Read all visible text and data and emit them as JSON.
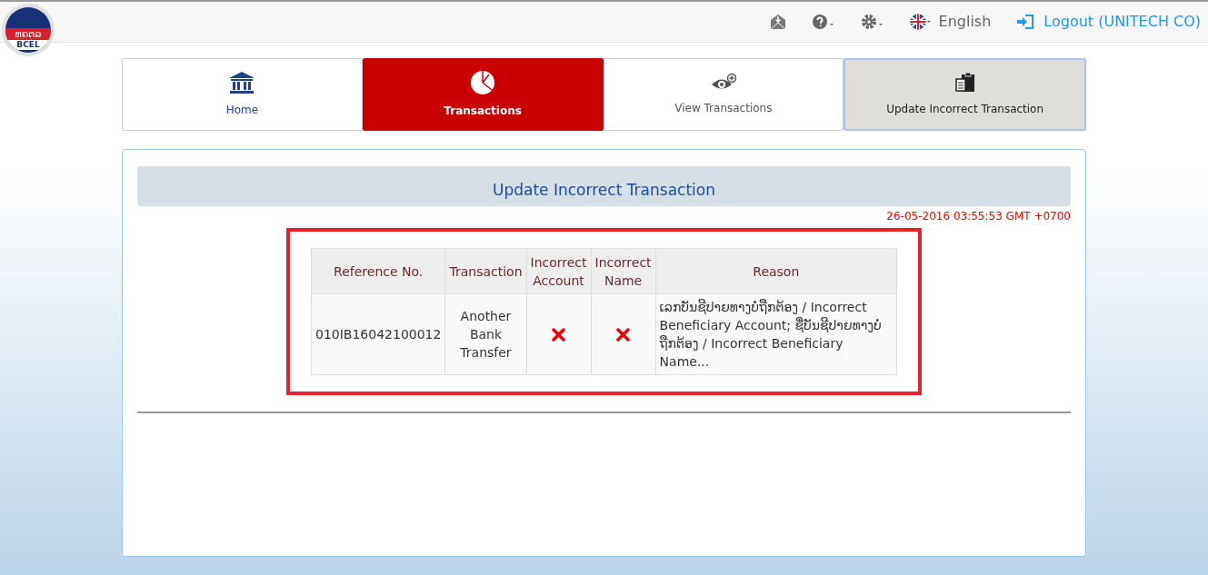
{
  "logo": {
    "script_text": "ທຄຕລ",
    "text": "BCEL"
  },
  "header": {
    "language": "English",
    "logout": "Logout (UNITECH CO)"
  },
  "tabs": [
    {
      "label": "Home",
      "kind": "home",
      "selected": false
    },
    {
      "label": "Transactions",
      "kind": "chart",
      "selected": true
    },
    {
      "label": "View Transactions",
      "kind": "eye",
      "selected": false
    },
    {
      "label": "Update Incorrect Transaction",
      "kind": "clipboard",
      "selected": false
    }
  ],
  "panel": {
    "title": "Update Incorrect Transaction",
    "timestamp": "26-05-2016 03:55:53 GMT +0700"
  },
  "table": {
    "columns": [
      "Reference No.",
      "Transaction",
      "Incorrect Account",
      "Incorrect Name",
      "Reason"
    ],
    "rows": [
      {
        "reference": "010IB16042100012",
        "transaction": "Another Bank Transfer",
        "incorrect_account": true,
        "incorrect_name": true,
        "reason": "ເລກບັນຊີປາຍທາງບໍ່ຖືກຕ້ອງ / Incorrect Beneficiary Account; ຊື່ບັນຊີປາຍທາງບໍ່ຖືກຕ້ອງ / Incorrect Beneficiary Name..."
      }
    ]
  }
}
